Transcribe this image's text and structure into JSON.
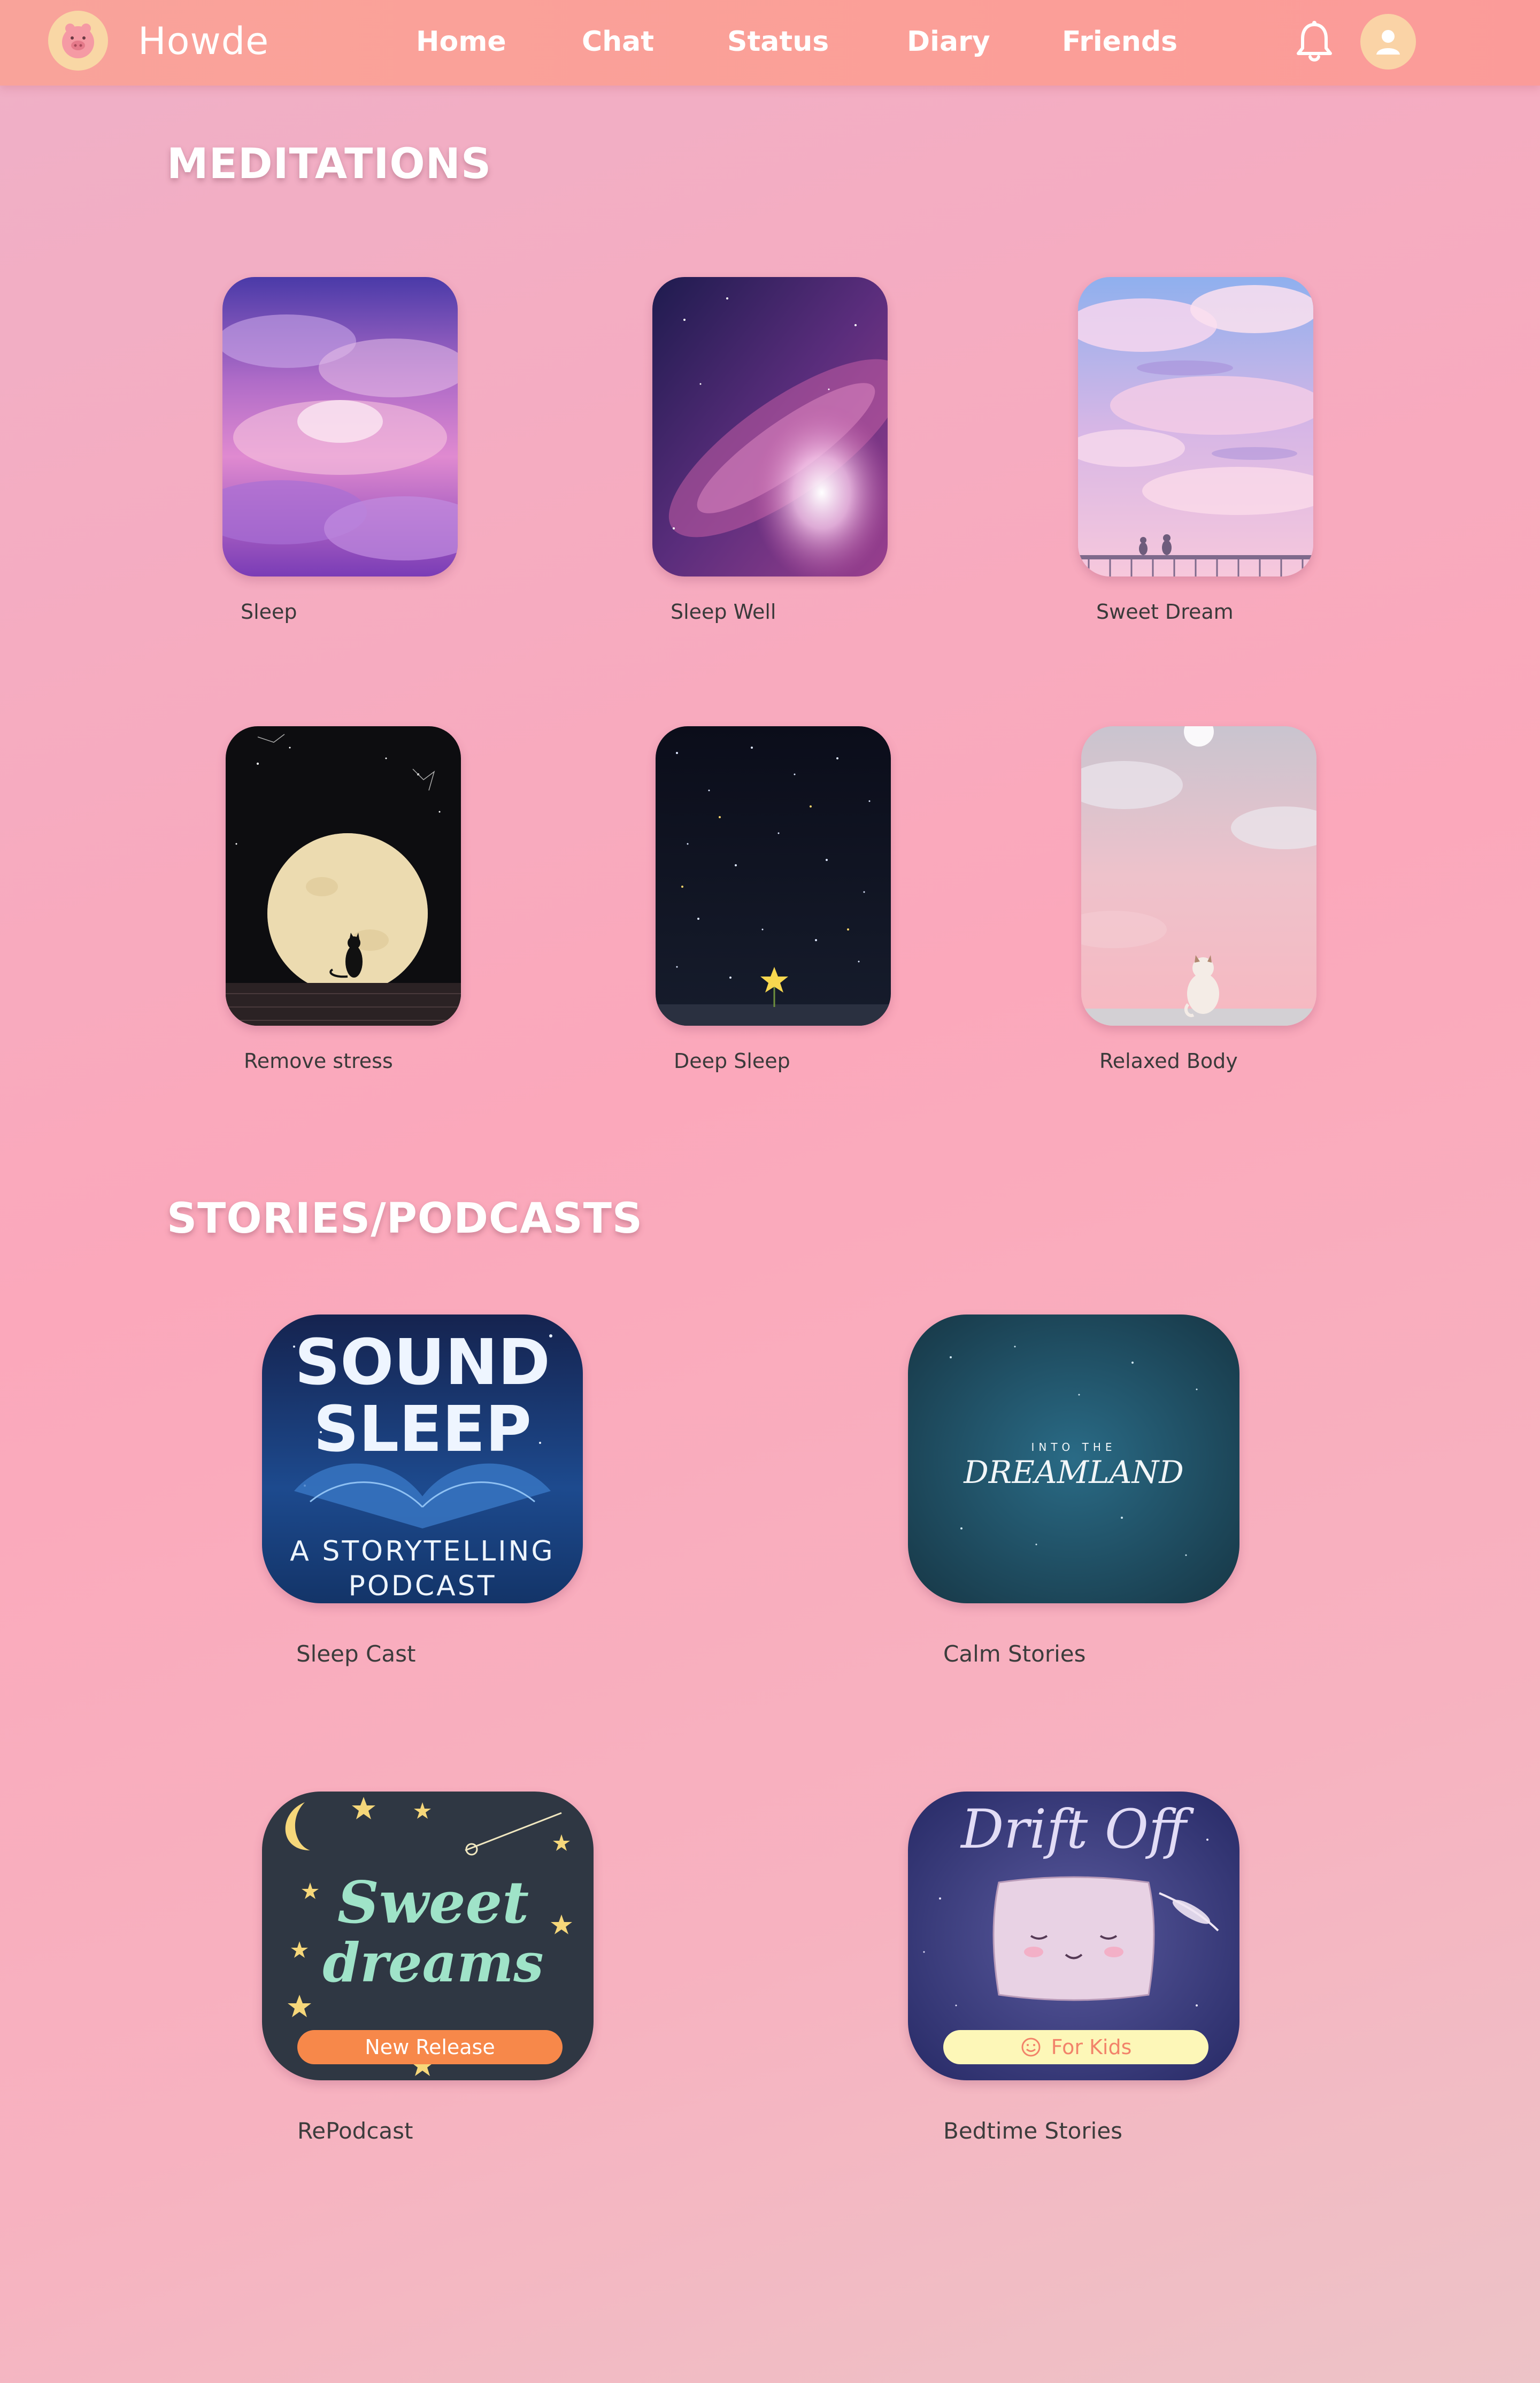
{
  "header": {
    "brand": "Howde",
    "nav": [
      "Home",
      "Chat",
      "Status",
      "Diary",
      "Friends"
    ],
    "icons": {
      "logo": "pig-logo-icon",
      "bell": "bell-icon",
      "avatar": "user-avatar-icon"
    }
  },
  "meditations": {
    "title": "MEDITATIONS",
    "items": [
      {
        "label": "Sleep",
        "art": "purple-clouds"
      },
      {
        "label": "Sleep Well",
        "art": "galaxy"
      },
      {
        "label": "Sweet Dream",
        "art": "pastel-sky-cats"
      },
      {
        "label": "Remove stress",
        "art": "full-moon-cat"
      },
      {
        "label": "Deep Sleep",
        "art": "starry-night-flower"
      },
      {
        "label": "Relaxed Body",
        "art": "pink-sky-cat"
      }
    ]
  },
  "podcasts": {
    "title": "STORIES/PODCASTS",
    "items": [
      {
        "label": "Sleep Cast",
        "art_text": [
          "SOUND",
          "SLEEP",
          "A STORYTELLING",
          "PODCAST"
        ]
      },
      {
        "label": "Calm Stories",
        "art_text": [
          "INTO THE",
          "DREAMLAND"
        ]
      },
      {
        "label": "RePodcast",
        "art_text": [
          "Sweet",
          "dreams"
        ],
        "badge": "New Release"
      },
      {
        "label": "Bedtime Stories",
        "art_text": [
          "Drift Off"
        ],
        "badge": "For Kids"
      }
    ]
  },
  "colors": {
    "navbar": "#fb9f98",
    "badge_new_release": "#f7884a",
    "badge_for_kids": "#fdf7b8"
  }
}
